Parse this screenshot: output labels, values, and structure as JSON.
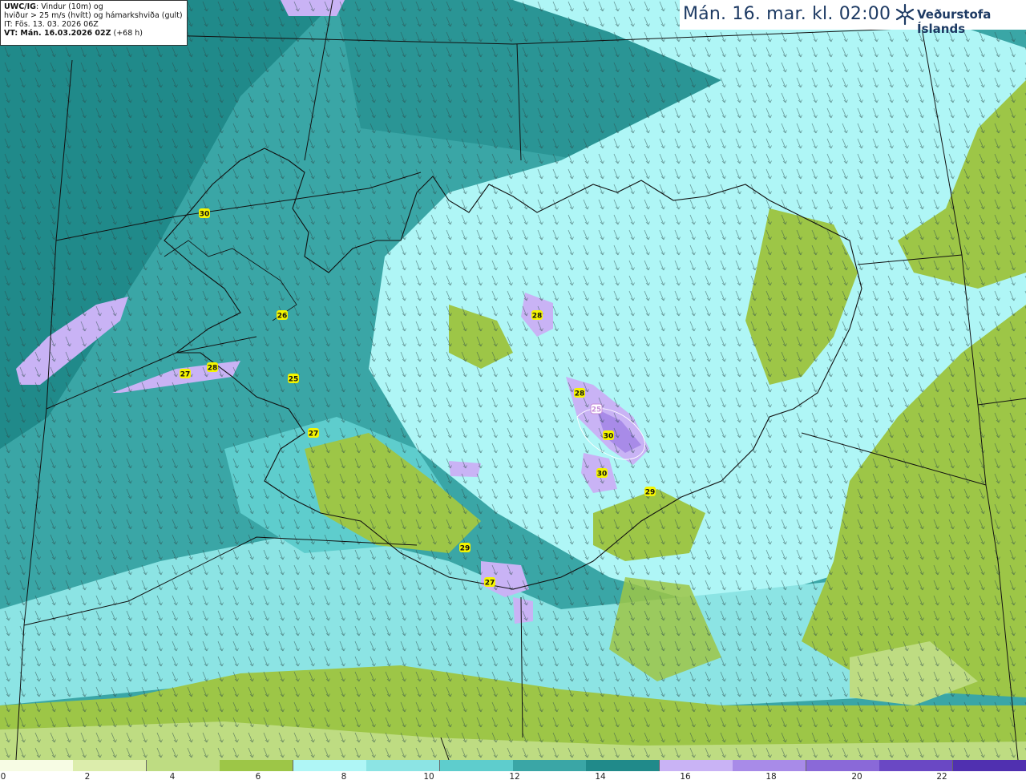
{
  "info": {
    "model": "UWC/IG",
    "line1": ": Vindur (10m) og",
    "line2": "hviður > 25 m/s (hvítt) og hámarkshviða (gult)",
    "line3": "IT: Fös. 13. 03. 2026 06Z",
    "vt_label": "VT: Mán. 16.03.2026 02Z",
    "vt_offset": " (+68 h)"
  },
  "header": {
    "title": "Mán. 16. mar. kl. 02:00",
    "logo_text": "Veðurstofa Íslands",
    "logo_icon": "snowflake-star-icon"
  },
  "legend": {
    "colors": [
      "#f7fce4",
      "#dcedac",
      "#bedc82",
      "#9dc647",
      "#aff6f6",
      "#8ce4e4",
      "#5ecdcd",
      "#3aa6a6",
      "#208a8a",
      "#c9b3f5",
      "#a88be8",
      "#8a69d8",
      "#6a48c4",
      "#5030b0"
    ],
    "labels": [
      "0",
      "2",
      "4",
      "6",
      "8",
      "10",
      "12",
      "14",
      "16",
      "18",
      "20",
      "22"
    ]
  },
  "gust_markers": [
    {
      "label": "30",
      "color": "#f5f500"
    },
    {
      "label": "26",
      "color": "#f5f500"
    },
    {
      "label": "27",
      "color": "#f5f500"
    },
    {
      "label": "28",
      "color": "#f5f500"
    },
    {
      "label": "25",
      "color": "#f5f500"
    },
    {
      "label": "27",
      "color": "#f5f500"
    },
    {
      "label": "28",
      "color": "#f5f500"
    },
    {
      "label": "28",
      "color": "#f5f500"
    },
    {
      "label": "25",
      "color": "#ffffff"
    },
    {
      "label": "30",
      "color": "#f5f500"
    },
    {
      "label": "30",
      "color": "#f5f500"
    },
    {
      "label": "29",
      "color": "#f5f500"
    },
    {
      "label": "29",
      "color": "#f5f500"
    },
    {
      "label": "27",
      "color": "#f5f500"
    }
  ]
}
